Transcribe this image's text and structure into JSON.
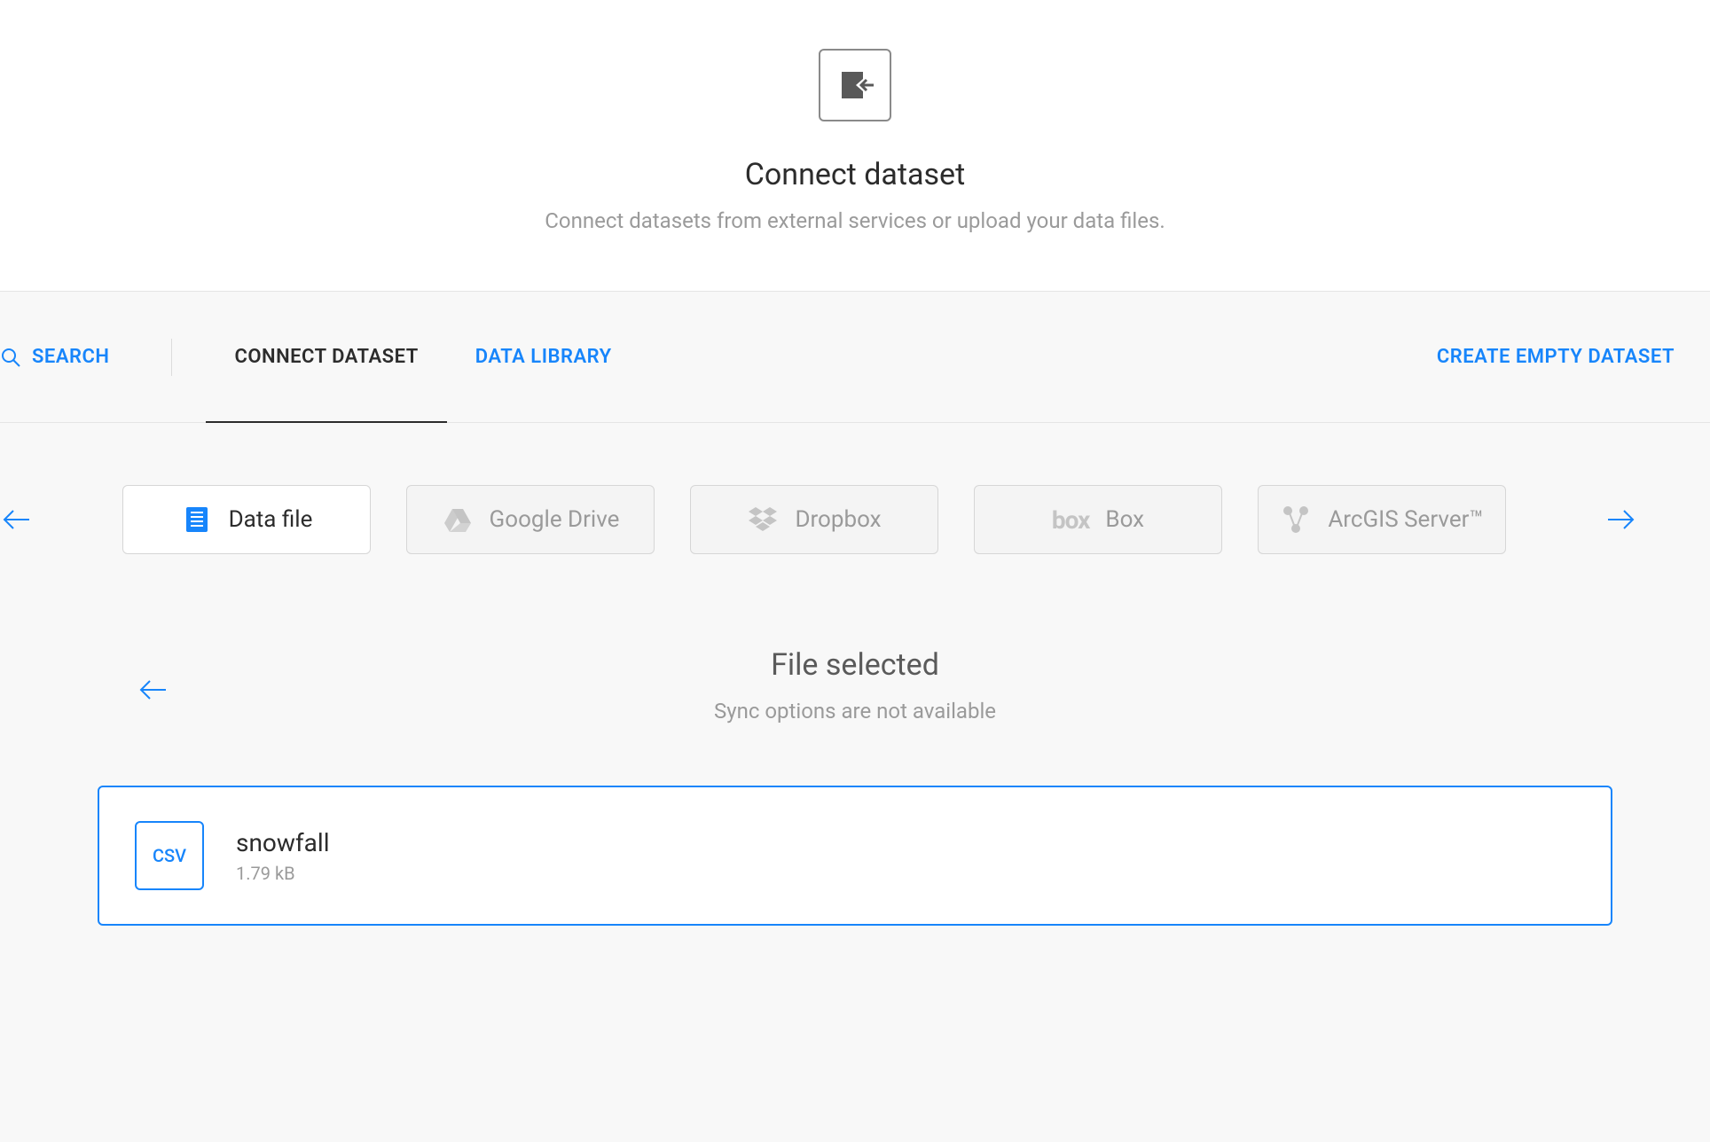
{
  "header": {
    "title": "Connect dataset",
    "subtitle": "Connect datasets from external services or upload your data files."
  },
  "tabs": {
    "search_label": "SEARCH",
    "connect_label": "CONNECT DATASET",
    "library_label": "DATA LIBRARY",
    "create_empty_label": "CREATE EMPTY DATASET"
  },
  "sources": {
    "data_file": "Data file",
    "google_drive": "Google Drive",
    "dropbox": "Dropbox",
    "box": "Box",
    "arcgis": "ArcGIS Server™"
  },
  "file_section": {
    "title": "File selected",
    "subtitle": "Sync options are not available"
  },
  "selected_file": {
    "type_badge": "CSV",
    "name": "snowfall",
    "size": "1.79 kB"
  }
}
